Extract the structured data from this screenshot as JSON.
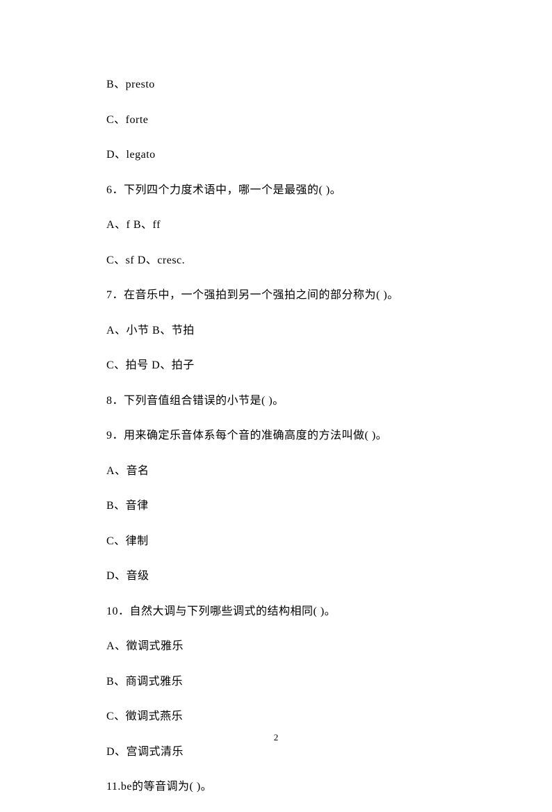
{
  "lines": [
    "B、presto",
    "C、forte",
    "D、legato",
    "6．下列四个力度术语中，哪一个是最强的(  )。",
    "A、f B、ff",
    "C、sf D、cresc.",
    "7．在音乐中，一个强拍到另一个强拍之间的部分称为(  )。",
    "A、小节  B、节拍",
    "C、拍号  D、拍子",
    "8．下列音值组合错误的小节是(  )。",
    "",
    "9．用来确定乐音体系每个音的准确高度的方法叫做(  )。",
    "A、音名",
    "B、音律",
    "C、律制",
    "D、音级",
    "10．自然大调与下列哪些调式的结构相同(  )。",
    "A、徵调式雅乐",
    "B、商调式雅乐",
    "C、徵调式燕乐",
    "D、宫调式清乐",
    "11.be的等音调为(  )。"
  ],
  "pageNumber": "2"
}
